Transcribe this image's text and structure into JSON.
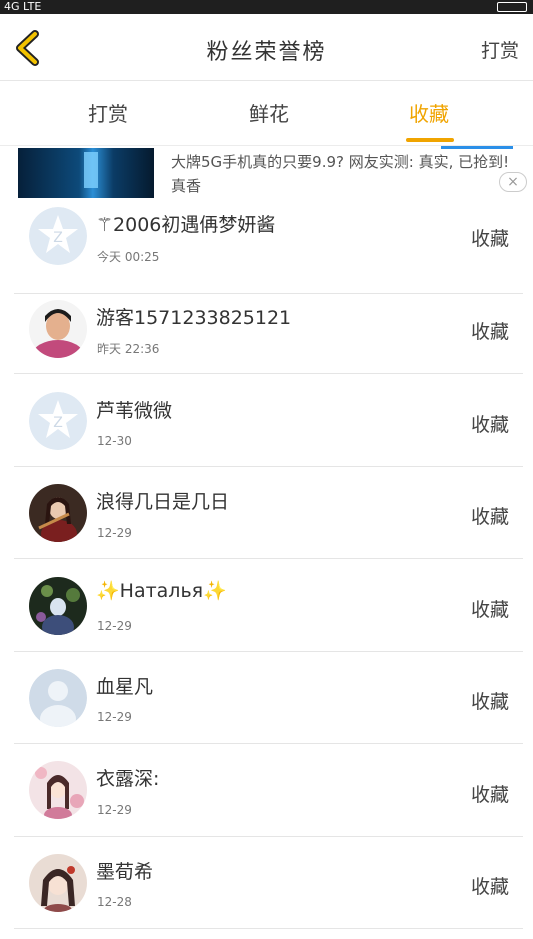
{
  "status": {
    "network": "4G LTE",
    "time": ""
  },
  "nav": {
    "title": "粉丝荣誉榜",
    "right_action": "打赏"
  },
  "tabs": [
    {
      "label": "打赏",
      "active": false
    },
    {
      "label": "鲜花",
      "active": false
    },
    {
      "label": "收藏",
      "active": true
    }
  ],
  "accent_color": "#f0a400",
  "ad": {
    "text": "大牌5G手机真的只要9.9? 网友实测: 真实, 已抢到! 真香",
    "close": "×"
  },
  "rows": [
    {
      "name": "⚚2006初遇侢梦妍酱",
      "time": "今天 00:25",
      "action": "收藏",
      "avatar": "qq-default"
    },
    {
      "name": "游客1571233825121",
      "time": "昨天 22:36",
      "action": "收藏",
      "avatar": "photo-woman"
    },
    {
      "name": "芦苇微微",
      "time": "12-30",
      "action": "收藏",
      "avatar": "qq-default"
    },
    {
      "name": "浪得几日是几日",
      "time": "12-29",
      "action": "收藏",
      "avatar": "photo-girl-violin"
    },
    {
      "name": "✨Наталья✨",
      "time": "12-29",
      "action": "收藏",
      "avatar": "photo-dark"
    },
    {
      "name": "血星凡",
      "time": "12-29",
      "action": "收藏",
      "avatar": "silhouette"
    },
    {
      "name": "衣露深:",
      "time": "12-29",
      "action": "收藏",
      "avatar": "photo-anime"
    },
    {
      "name": "墨荀希",
      "time": "12-28",
      "action": "收藏",
      "avatar": "photo-anime-2"
    }
  ]
}
